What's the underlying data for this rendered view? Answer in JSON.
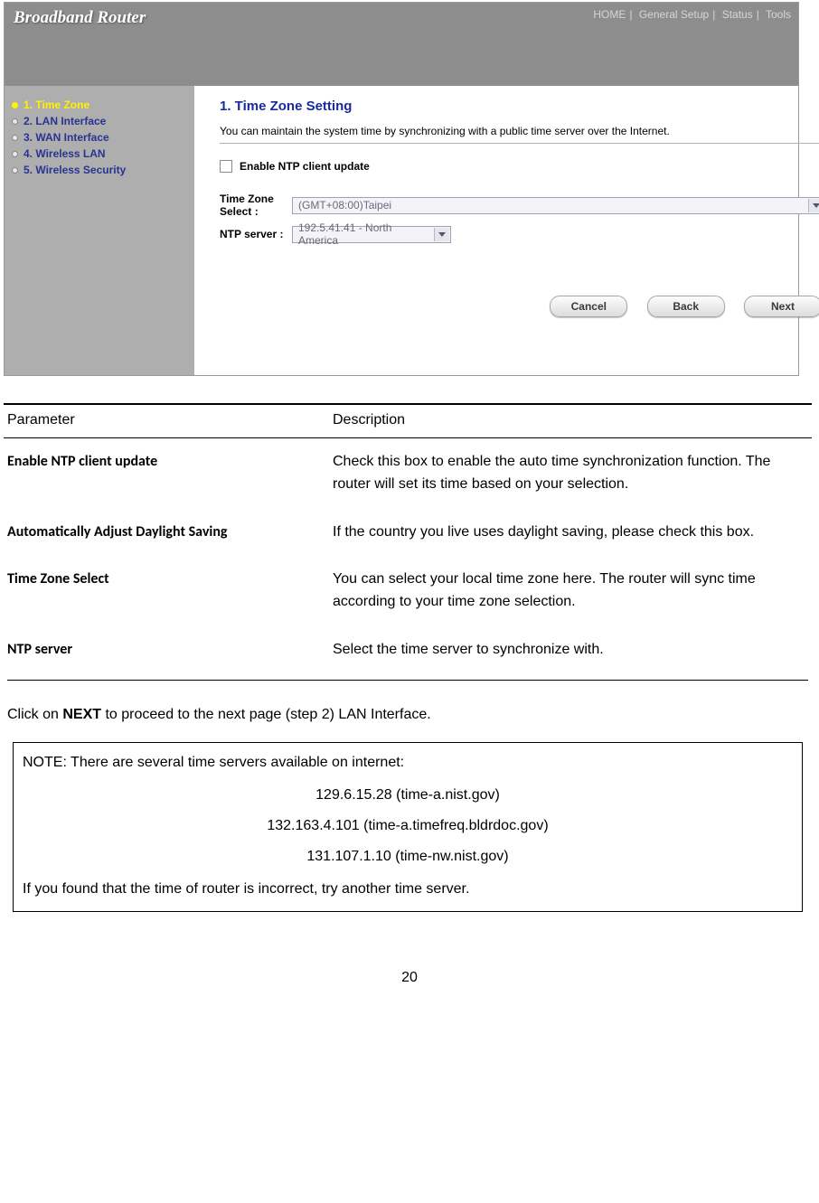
{
  "router": {
    "title": "Broadband Router",
    "nav": [
      "HOME",
      "General Setup",
      "Status",
      "Tools"
    ],
    "sidebar": {
      "items": [
        {
          "label": "1. Time Zone",
          "active": true
        },
        {
          "label": "2. LAN Interface",
          "active": false
        },
        {
          "label": "3. WAN Interface",
          "active": false
        },
        {
          "label": "4. Wireless LAN",
          "active": false
        },
        {
          "label": "5. Wireless Security",
          "active": false
        }
      ]
    },
    "panel": {
      "heading": "1. Time Zone Setting",
      "description": "You can maintain the system time by synchronizing with a public time server over the Internet.",
      "enable_label": "Enable NTP client update",
      "tz_label": "Time Zone Select :",
      "tz_value": "(GMT+08:00)Taipei",
      "ntp_label": "NTP server :",
      "ntp_value": "192.5.41.41 - North America",
      "buttons": {
        "cancel": "Cancel",
        "back": "Back",
        "next": "Next"
      }
    }
  },
  "doc": {
    "headers": {
      "param": "Parameter",
      "desc": "Description"
    },
    "rows": [
      {
        "param": "Enable NTP client update",
        "desc": "Check this box to enable the auto time synchronization function. The router will set its time based on your selection."
      },
      {
        "param": "Automatically Adjust Daylight Saving",
        "desc": "If the country you live uses daylight saving, please check this box."
      },
      {
        "param": "Time Zone Select",
        "desc": "You can select your local time zone here. The router will sync time according to your time zone selection."
      },
      {
        "param": "NTP server",
        "desc": "Select the time server to synchronize with."
      }
    ],
    "instruction_pre": "Click on ",
    "instruction_bold": "NEXT",
    "instruction_post": " to proceed to the next page (step 2) LAN Interface.",
    "note": {
      "title": "NOTE: There are several time servers available on internet:",
      "servers": [
        "129.6.15.28 (time-a.nist.gov)",
        "132.163.4.101 (time-a.timefreq.bldrdoc.gov)",
        "131.107.1.10 (time-nw.nist.gov)"
      ],
      "footer": "If you found that the time of router is incorrect, try another time server."
    }
  },
  "page_number": "20"
}
